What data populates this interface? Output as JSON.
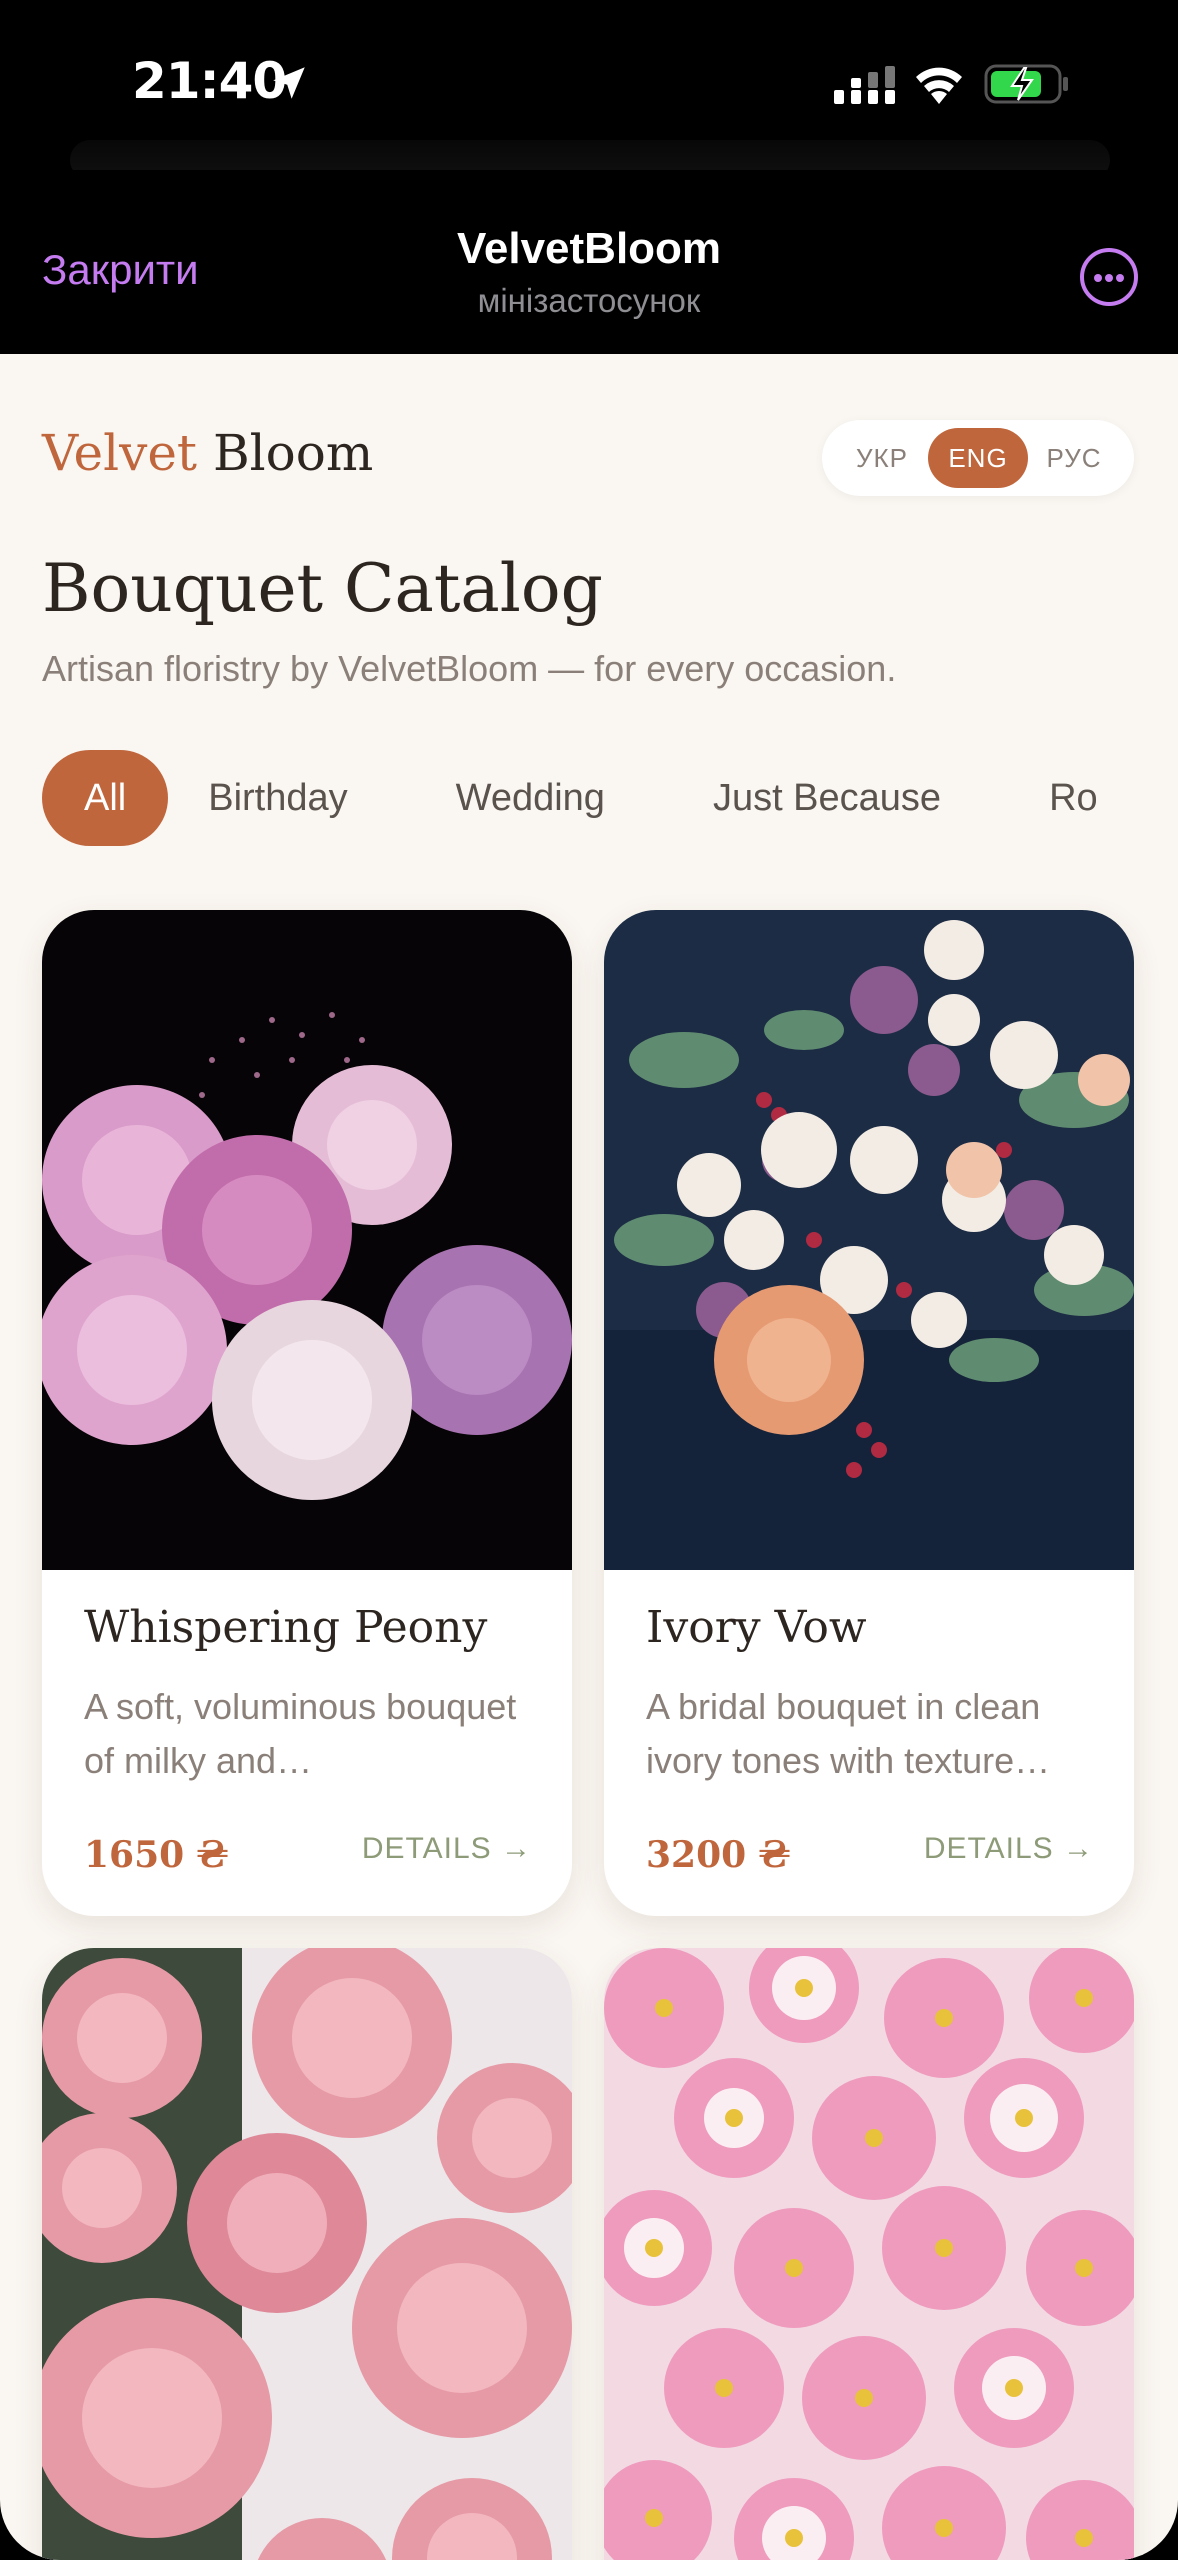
{
  "status_bar": {
    "time": "21:40"
  },
  "tg_header": {
    "close": "Закрити",
    "title": "VelvetBloom",
    "subtitle": "мінізастосунок"
  },
  "brand": {
    "part1": "Velvet",
    "part2": "Bloom"
  },
  "languages": [
    {
      "label": "УКР",
      "active": false
    },
    {
      "label": "ENG",
      "active": true
    },
    {
      "label": "РУС",
      "active": false
    }
  ],
  "page": {
    "title": "Bouquet Catalog",
    "subtitle": "Artisan floristry by VelvetBloom — for every occasion."
  },
  "categories": [
    {
      "label": "All",
      "active": true
    },
    {
      "label": "Birthday",
      "active": false
    },
    {
      "label": "Wedding",
      "active": false
    },
    {
      "label": "Just Because",
      "active": false
    },
    {
      "label": "Ro",
      "active": false
    }
  ],
  "products": [
    {
      "name": "Whispering Peony",
      "desc": "A soft, voluminous bouquet of milky and…",
      "price": "1650 ₴",
      "details": "DETAILS →"
    },
    {
      "name": "Ivory Vow",
      "desc": "A bridal bouquet in clean ivory tones with texture…",
      "price": "3200 ₴",
      "details": "DETAILS →"
    }
  ],
  "colors": {
    "accent": "#c0663d",
    "tg_accent": "#c57cf0",
    "background": "#faf6f1",
    "details": "#8d9b78"
  }
}
